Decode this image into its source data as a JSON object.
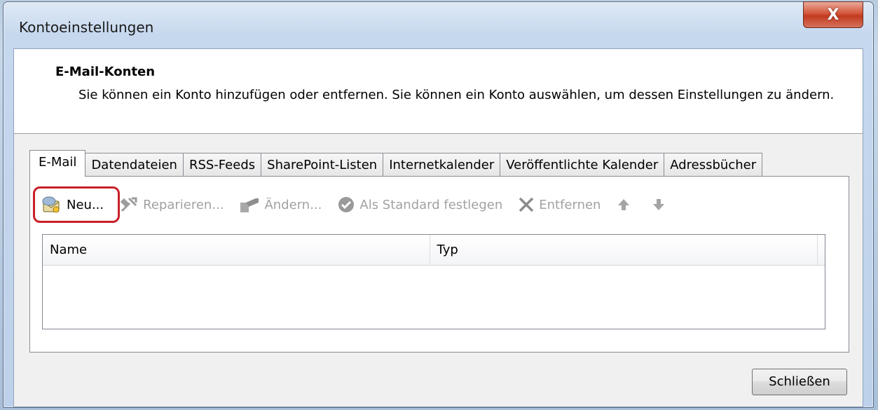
{
  "window": {
    "title": "Kontoeinstellungen",
    "close_glyph": "X"
  },
  "header": {
    "title": "E-Mail-Konten",
    "description": "Sie können ein Konto hinzufügen oder entfernen. Sie können ein Konto auswählen, um dessen Einstellungen zu ändern."
  },
  "tabs": [
    {
      "label": "E-Mail",
      "active": true
    },
    {
      "label": "Datendateien",
      "active": false
    },
    {
      "label": "RSS-Feeds",
      "active": false
    },
    {
      "label": "SharePoint-Listen",
      "active": false
    },
    {
      "label": "Internetkalender",
      "active": false
    },
    {
      "label": "Veröffentlichte Kalender",
      "active": false
    },
    {
      "label": "Adressbücher",
      "active": false
    }
  ],
  "toolbar": {
    "new_label": "Neu...",
    "repair_label": "Reparieren...",
    "change_label": "Ändern...",
    "default_label": "Als Standard festlegen",
    "remove_label": "Entfernen"
  },
  "list": {
    "columns": [
      "Name",
      "Typ"
    ],
    "rows": []
  },
  "footer": {
    "close_label": "Schließen"
  },
  "colors": {
    "highlight": "#c8202a",
    "disabled_text": "#a2a2a2"
  }
}
